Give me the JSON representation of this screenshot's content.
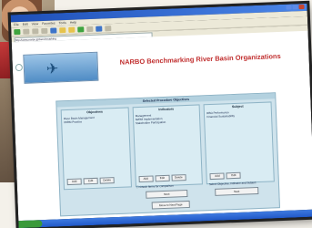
{
  "browser": {
    "menu": [
      "File",
      "Edit",
      "View",
      "Favorites",
      "Tools",
      "Help"
    ],
    "address": "http://www.narbo.jp/benchmarking"
  },
  "page": {
    "title": "NARBO Benchmarking River Basin Organizations",
    "form_header": "Selected Procedure Objectives",
    "columns": [
      {
        "title": "Objectives",
        "items": [
          "River Basin Management",
          "IWRM Practice"
        ]
      },
      {
        "title": "Indicators",
        "items": [
          "Management",
          "IWRM Implementation",
          "Stakeholder Participation"
        ]
      },
      {
        "title": "Subject",
        "items": [
          "RBO Performance",
          "Financial Sustainability"
        ]
      }
    ],
    "buttons": {
      "add": "Add",
      "edit": "Edit",
      "delete": "Delete",
      "new": "Next",
      "submit": "Move to Next Page"
    },
    "checkbox_label": "Check Items for comparison",
    "subject_hint": "Select Objective, Indicator and Subject"
  }
}
